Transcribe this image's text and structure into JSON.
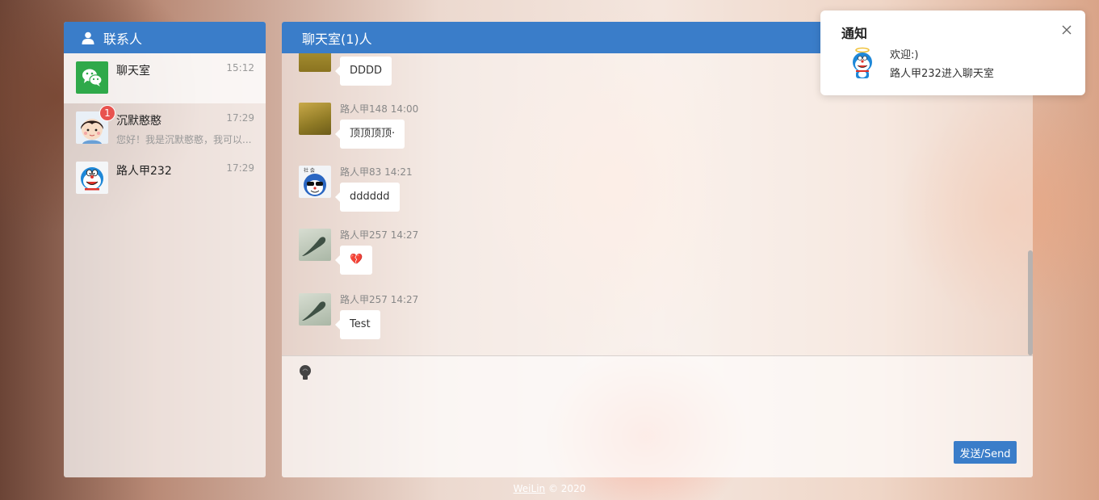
{
  "contacts_panel": {
    "title": "联系人",
    "items": [
      {
        "name": "聊天室",
        "time": "15:12",
        "preview": ""
      },
      {
        "name": "沉默憨憨",
        "time": "17:29",
        "preview": "您好！我是沉默憨憨，我可以...",
        "badge": "1"
      },
      {
        "name": "路人甲232",
        "time": "17:29",
        "preview": ""
      }
    ]
  },
  "chat": {
    "title": "聊天室(1)人",
    "messages": [
      {
        "meta": "",
        "text": "DDDD"
      },
      {
        "meta": "路人甲148 14:00",
        "text": "顶顶顶顶·"
      },
      {
        "meta": "路人甲83 14:21",
        "text": "dddddd"
      },
      {
        "meta": "路人甲257 14:27",
        "text": "💔"
      },
      {
        "meta": "路人甲257 14:27",
        "text": "Test"
      }
    ],
    "send_label": "发送/Send"
  },
  "footer": {
    "author": "WeiLin",
    "copyright": "© 2020"
  },
  "notification": {
    "title": "通知",
    "line1": "欢迎:)",
    "line2": "路人甲232进入聊天室"
  },
  "colors": {
    "accent": "#3a7dc9",
    "badge": "#e8534f",
    "wechat_green": "#2fa94a"
  }
}
